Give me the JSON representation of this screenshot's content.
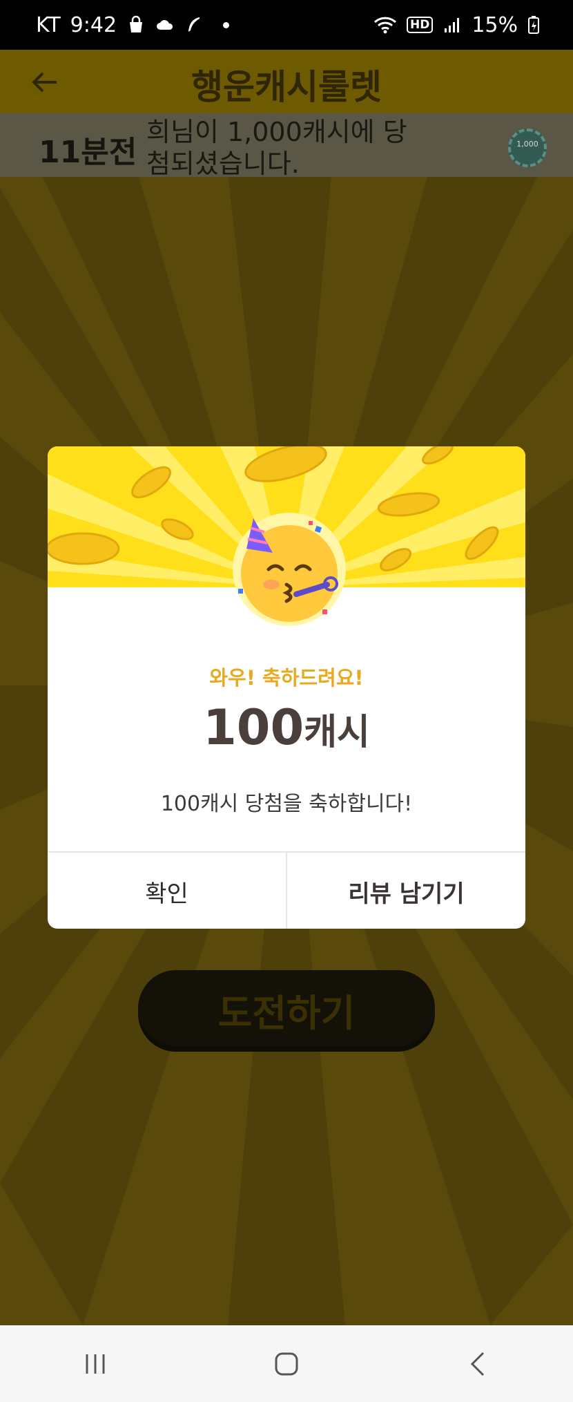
{
  "status_bar": {
    "carrier": "KT",
    "time": "9:42",
    "network_badge": "HD",
    "battery": "15%",
    "icons": [
      "bag-icon",
      "cloud-icon",
      "feather-icon",
      "dot-icon",
      "wifi-icon",
      "hd-icon",
      "signal-icon",
      "battery-icon"
    ]
  },
  "header": {
    "title": "행운캐시룰렛",
    "back_icon": "arrow-left-icon"
  },
  "ticker": {
    "time_ago": "11분전",
    "message": "희님이 1,000캐시에 당첨되셨습니다.",
    "chip_label": "1,000"
  },
  "challenge_button": {
    "label": "도전하기"
  },
  "dialog": {
    "emoji_icon": "party-face-icon",
    "congrats": "와우! 축하드려요!",
    "amount_number": "100",
    "amount_unit": "캐시",
    "message": "100캐시 당첨을 축하합니다!",
    "buttons": {
      "confirm": "확인",
      "review": "리뷰 남기기"
    }
  },
  "nav_bar": {
    "icons": [
      "recent-apps-icon",
      "home-icon",
      "back-icon"
    ]
  },
  "colors": {
    "banner_yellow": "#ffdf19",
    "congrats_orange": "#e9a91e",
    "amount_text": "#4b3f3c"
  }
}
